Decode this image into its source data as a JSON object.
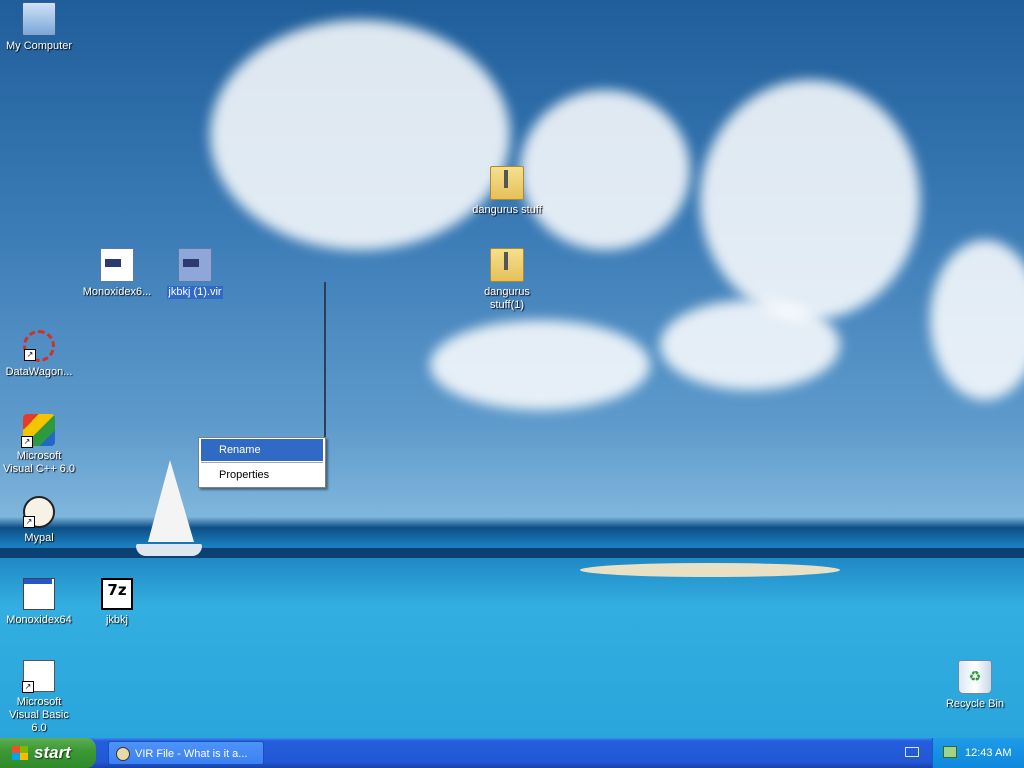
{
  "desktop": {
    "icons": {
      "my_computer": "My Computer",
      "monoxidex6_vir": "Monoxidex6...",
      "jkbkj_vir": "jkbkj (1).vir",
      "dangurus_stuff": "dangurus stuff",
      "dangurus_stuff_1": "dangurus stuff(1)",
      "datawagon": "DataWagon...",
      "ms_visual_cpp": "Microsoft Visual C++ 6.0",
      "mypal": "Mypal",
      "monoxidex64": "Monoxidex64",
      "jkbkj": "jkbkj",
      "ms_visual_basic": "Microsoft Visual Basic 6.0",
      "recycle_bin": "Recycle Bin"
    },
    "sevenz_glyph": "7z"
  },
  "context_menu": {
    "items": [
      "Rename",
      "Properties"
    ],
    "active_index": 0
  },
  "taskbar": {
    "start_label": "start",
    "tasks": [
      {
        "label": "VIR File - What is it a..."
      }
    ],
    "clock": "12:43 AM"
  },
  "colors": {
    "taskbar_blue": "#245edc",
    "start_green": "#3c9a36",
    "selection_blue": "#316ac5",
    "tray_blue": "#0f88dc"
  }
}
